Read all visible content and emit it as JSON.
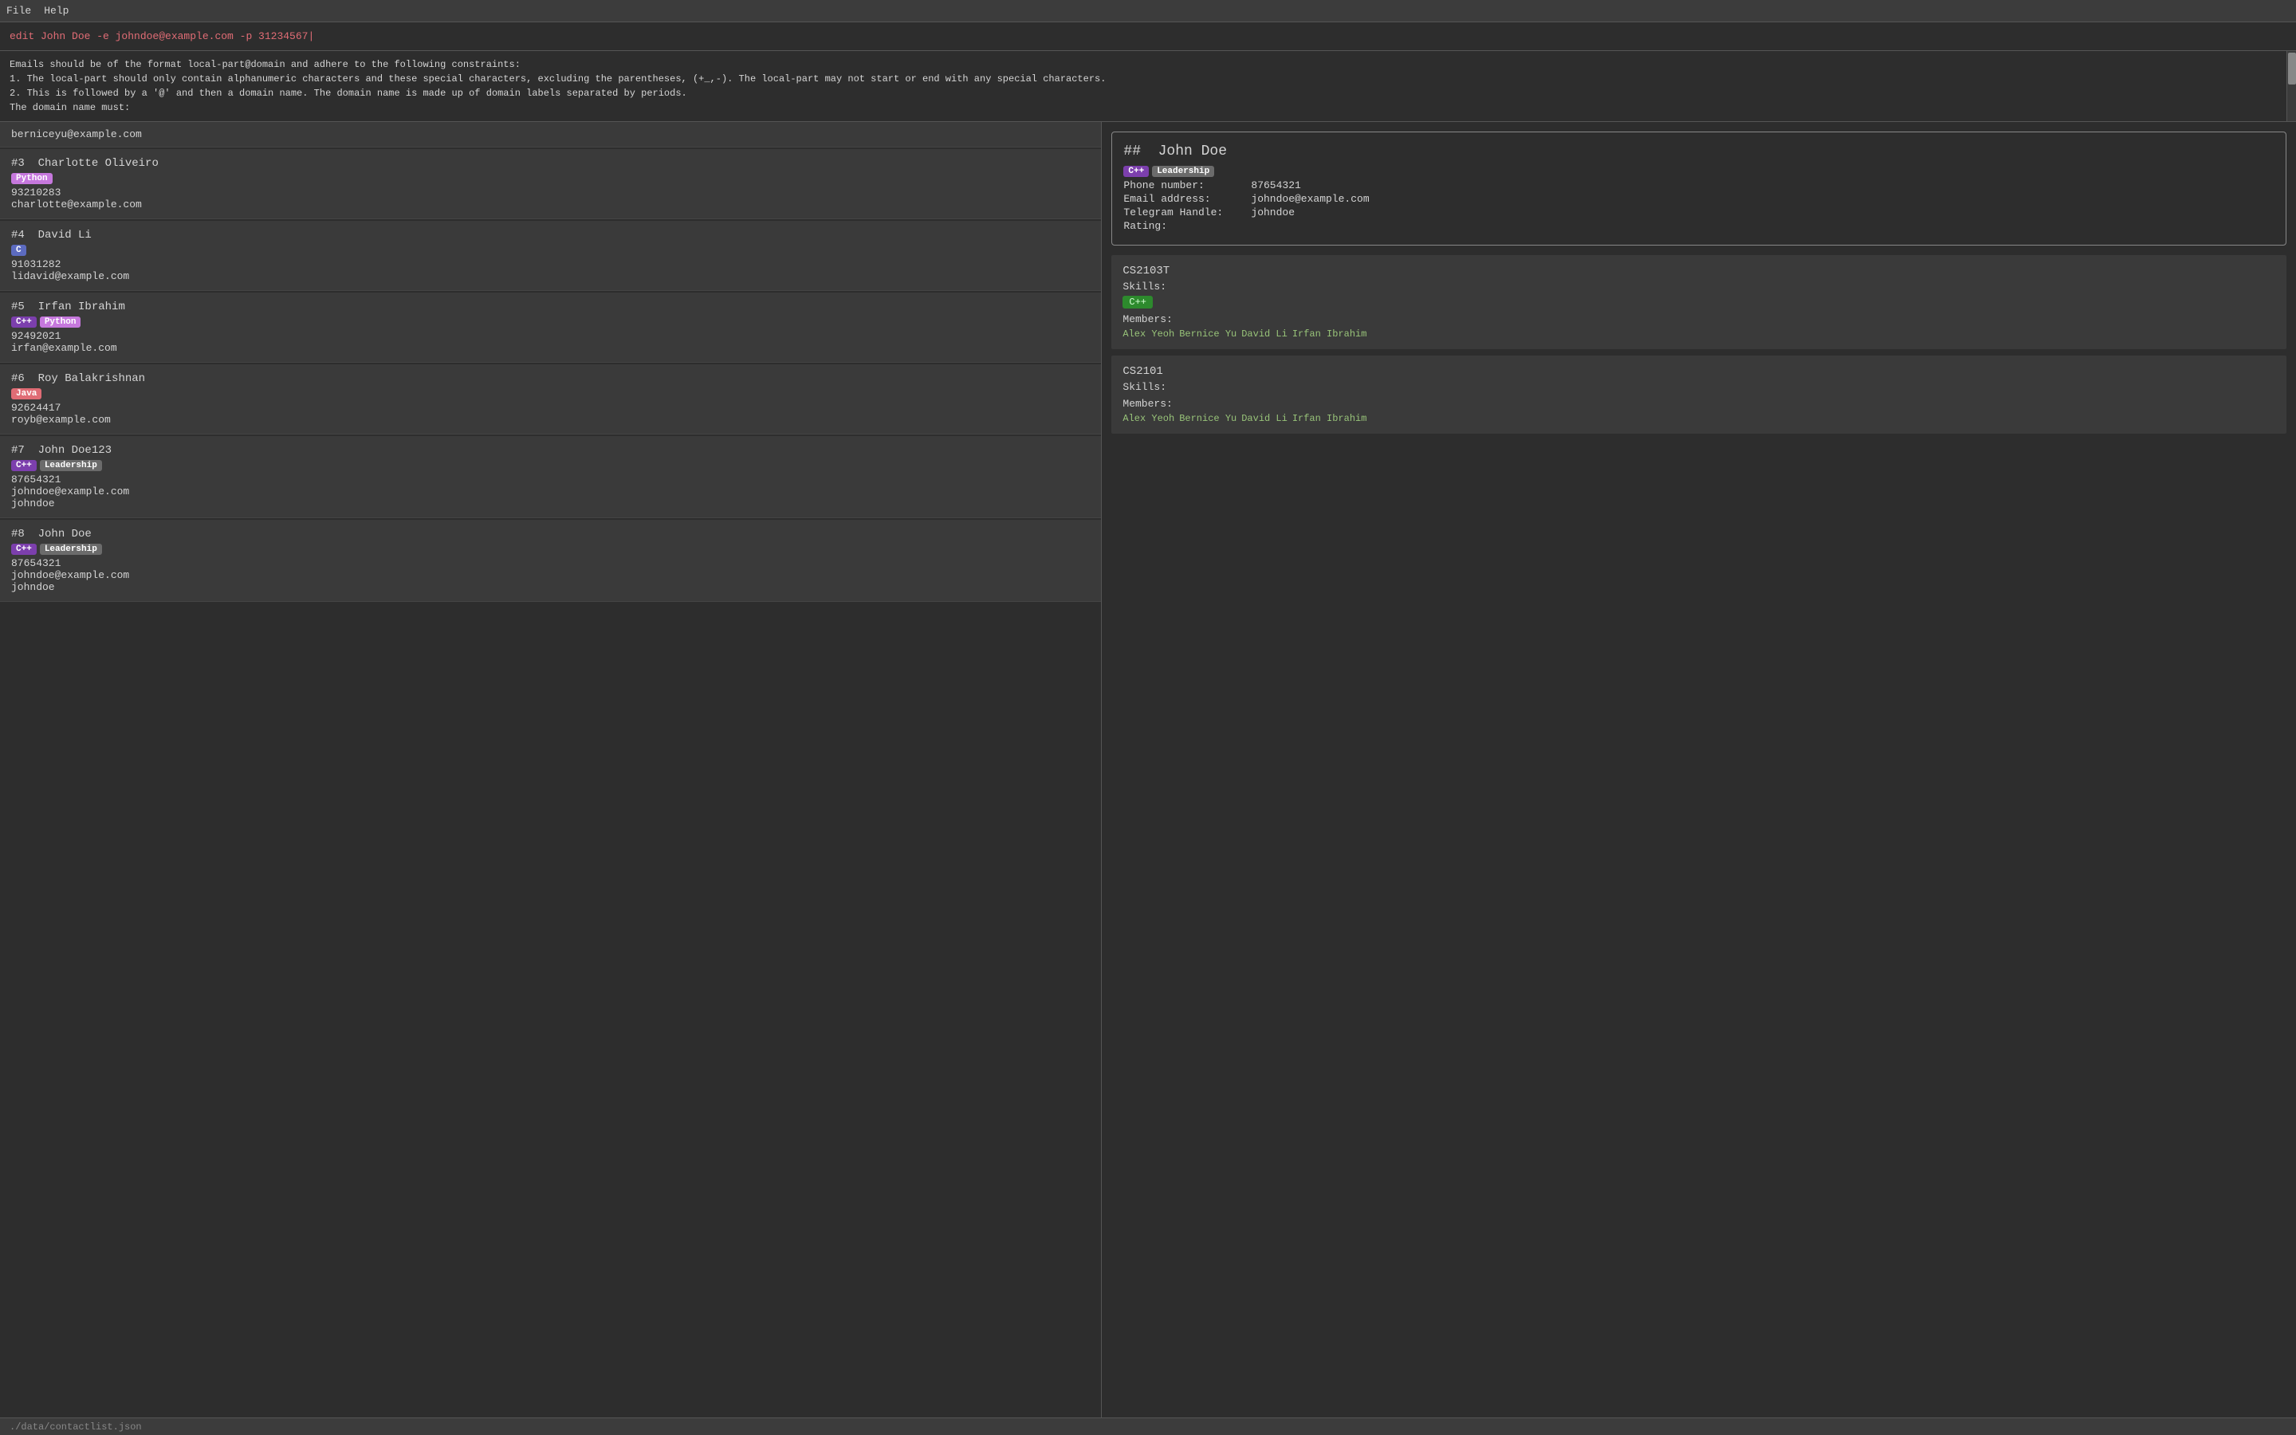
{
  "menubar": {
    "items": [
      "File",
      "Help"
    ]
  },
  "command": {
    "text": "edit John Doe -e johndoe@example.com -p 31234567|"
  },
  "info": {
    "lines": [
      "Emails should be of the format local-part@domain and adhere to the following constraints:",
      "1. The local-part should only contain alphanumeric characters and these special characters, excluding the parentheses, (+_,-). The local-part may not start or end with any special characters.",
      "2. This is followed by a '@' and then a domain name. The domain name is made up of domain labels separated by periods.",
      "The domain name must:"
    ]
  },
  "contacts": [
    {
      "id": "",
      "name": "berniceyu@example.com",
      "tags": [],
      "phone": "",
      "email": "",
      "telegram": "",
      "show_email_only": true
    },
    {
      "id": "#3",
      "name": "Charlotte Oliveiro",
      "tags": [
        "Python"
      ],
      "phone": "93210283",
      "email": "charlotte@example.com",
      "telegram": "",
      "show_email_only": false
    },
    {
      "id": "#4",
      "name": "David Li",
      "tags": [
        "C"
      ],
      "phone": "91031282",
      "email": "lidavid@example.com",
      "telegram": "",
      "show_email_only": false
    },
    {
      "id": "#5",
      "name": "Irfan Ibrahim",
      "tags": [
        "C++",
        "Python"
      ],
      "phone": "92492021",
      "email": "irfan@example.com",
      "telegram": "",
      "show_email_only": false
    },
    {
      "id": "#6",
      "name": "Roy Balakrishnan",
      "tags": [
        "Java"
      ],
      "phone": "92624417",
      "email": "royb@example.com",
      "telegram": "",
      "show_email_only": false
    },
    {
      "id": "#7",
      "name": "John Doe123",
      "tags": [
        "C++",
        "Leadership"
      ],
      "phone": "87654321",
      "email": "johndoe@example.com",
      "telegram": "johndoe",
      "show_email_only": false
    },
    {
      "id": "#8",
      "name": "John Doe",
      "tags": [
        "C++",
        "Leadership"
      ],
      "phone": "87654321",
      "email": "johndoe@example.com",
      "telegram": "johndoe",
      "show_email_only": false
    }
  ],
  "detail": {
    "person": {
      "id": "##",
      "name": "John Doe",
      "tags": [
        "C++",
        "Leadership"
      ],
      "phone_label": "Phone number:",
      "phone_value": "87654321",
      "email_label": "Email address:",
      "email_value": "johndoe@example.com",
      "telegram_label": "Telegram Handle:",
      "telegram_value": "johndoe",
      "rating_label": "Rating:",
      "rating_value": ""
    },
    "courses": [
      {
        "title": "CS2103T",
        "skills_label": "Skills:",
        "skills": [
          "C++"
        ],
        "members_label": "Members:",
        "members": [
          "Alex Yeoh",
          "Bernice Yu",
          "David Li",
          "Irfan Ibrahim"
        ]
      },
      {
        "title": "CS2101",
        "skills_label": "Skills:",
        "skills": [],
        "members_label": "Members:",
        "members": [
          "Alex Yeoh",
          "Bernice Yu",
          "David Li",
          "Irfan Ibrahim"
        ]
      }
    ]
  },
  "statusbar": {
    "path": "./data/contactlist.json"
  }
}
